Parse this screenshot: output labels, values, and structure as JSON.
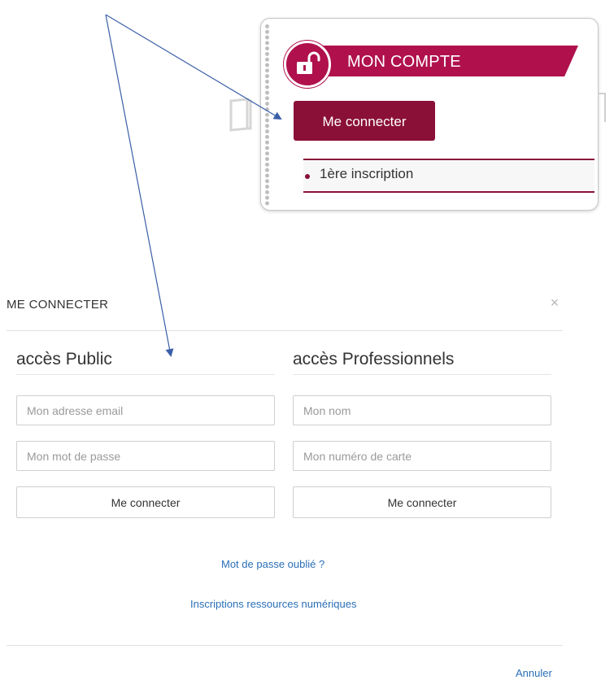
{
  "account_widget": {
    "title": "MON COMPTE",
    "connect_button": "Me connecter",
    "first_signup": "1ère inscription",
    "icons": {
      "lock": "unlock-icon",
      "book": "book-icon"
    },
    "colors": {
      "brand": "#b0114d",
      "button": "#8a1038"
    }
  },
  "modal": {
    "title": "ME CONNECTER",
    "close": "×",
    "public": {
      "heading": "accès Public",
      "email_placeholder": "Mon adresse email",
      "password_placeholder": "Mon mot de passe",
      "submit": "Me connecter"
    },
    "professional": {
      "heading": "accès Professionnels",
      "name_placeholder": "Mon nom",
      "card_placeholder": "Mon numéro de carte",
      "submit": "Me connecter"
    },
    "forgot_password": "Mot de passe oublié ?",
    "digital_signup": "Inscriptions ressources numériques",
    "cancel": "Annuler",
    "colors": {
      "link": "#2a6fb7"
    }
  },
  "annotation": {
    "arrow_color": "#3a5ea8"
  }
}
